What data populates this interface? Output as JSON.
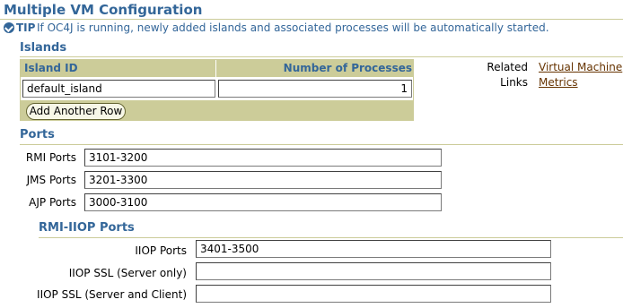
{
  "header": {
    "title": "Multiple VM Configuration"
  },
  "tip": {
    "label": "TIP",
    "text": "If OC4J is running, newly added islands and associated processes will be automatically started."
  },
  "islands": {
    "heading": "Islands",
    "columns": {
      "island_id": "Island ID",
      "num_processes": "Number of Processes"
    },
    "rows": [
      {
        "island_id": "default_island",
        "num_processes": "1"
      }
    ],
    "add_row_label": "Add Another Row"
  },
  "related_links": {
    "label_line1": "Related",
    "label_line2": "Links",
    "link1": "Virtual Machine",
    "link2": "Metrics"
  },
  "ports": {
    "heading": "Ports",
    "rmi": {
      "label": "RMI Ports",
      "value": "3101-3200"
    },
    "jms": {
      "label": "JMS Ports",
      "value": "3201-3300"
    },
    "ajp": {
      "label": "AJP Ports",
      "value": "3000-3100"
    }
  },
  "rmi_iiop": {
    "heading": "RMI-IIOP Ports",
    "iiop": {
      "label": "IIOP Ports",
      "value": "3401-3500"
    },
    "iiop_ssl_server": {
      "label": "IIOP SSL (Server only)",
      "value": ""
    },
    "iiop_ssl_client": {
      "label": "IIOP SSL (Server and Client)",
      "value": ""
    }
  }
}
